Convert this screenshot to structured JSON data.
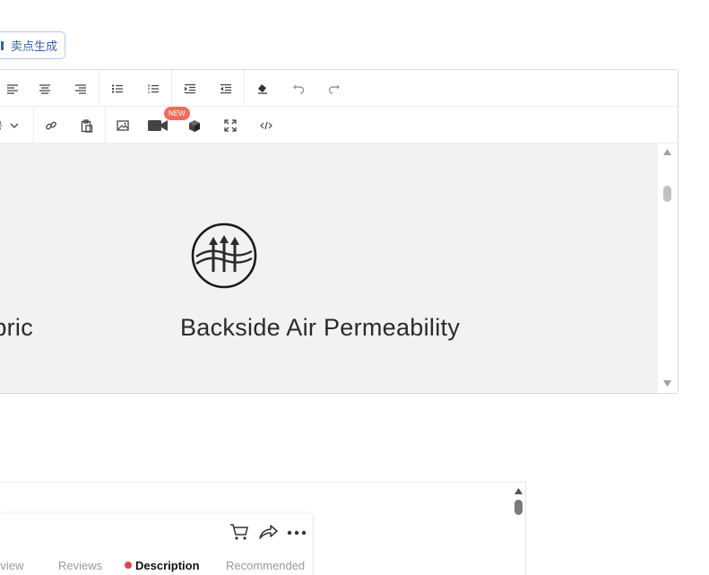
{
  "generate_button": {
    "label": "卖点生成"
  },
  "editor": {
    "toolbar_row1": [
      "align-left-icon",
      "align-center-icon",
      "align-right-icon",
      "bullet-list-icon",
      "numbered-list-icon",
      "indent-icon",
      "outdent-icon",
      "eraser-icon",
      "undo-icon",
      "redo-icon"
    ],
    "toolbar_row2": [
      "font-size-dropdown",
      "link-icon",
      "paste-icon",
      "image-icon",
      "video-icon",
      "cube-icon",
      "fullscreen-icon",
      "code-icon"
    ],
    "dropdown_partial_text": "号",
    "new_badge": "NEW",
    "content": {
      "left_feature_label": "abric",
      "right_feature_label": "Backside Air Permeability"
    }
  },
  "preview": {
    "tabs": [
      {
        "label": "rview",
        "active": false
      },
      {
        "label": "Reviews",
        "active": false
      },
      {
        "label": "Description",
        "active": true
      },
      {
        "label": "Recommended",
        "active": false
      }
    ]
  }
}
